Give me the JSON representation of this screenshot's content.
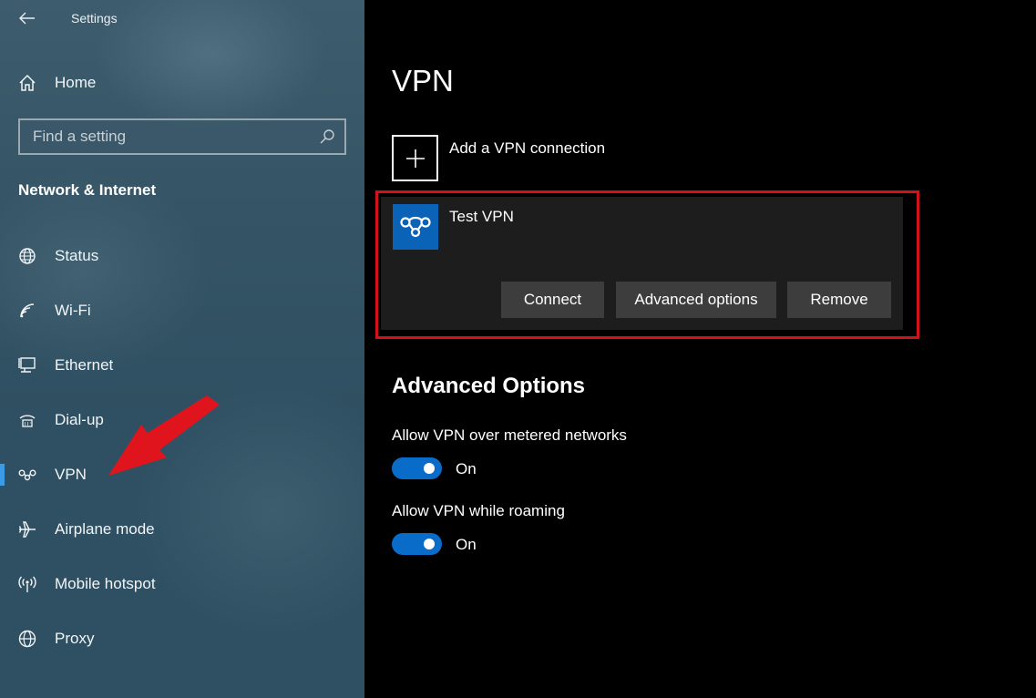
{
  "window": {
    "title": "Settings"
  },
  "sidebar": {
    "home_label": "Home",
    "search_placeholder": "Find a setting",
    "section_title": "Network & Internet",
    "items": [
      {
        "label": "Status",
        "icon": "globe-status-icon"
      },
      {
        "label": "Wi-Fi",
        "icon": "wifi-icon"
      },
      {
        "label": "Ethernet",
        "icon": "ethernet-icon"
      },
      {
        "label": "Dial-up",
        "icon": "dialup-icon"
      },
      {
        "label": "VPN",
        "icon": "vpn-icon",
        "active": true
      },
      {
        "label": "Airplane mode",
        "icon": "airplane-icon"
      },
      {
        "label": "Mobile hotspot",
        "icon": "hotspot-icon"
      },
      {
        "label": "Proxy",
        "icon": "globe-icon"
      }
    ]
  },
  "main": {
    "title": "VPN",
    "add_label": "Add a VPN connection",
    "connection": {
      "name": "Test VPN",
      "connect_label": "Connect",
      "advanced_label": "Advanced options",
      "remove_label": "Remove"
    },
    "advanced": {
      "title": "Advanced Options",
      "metered": {
        "label": "Allow VPN over metered networks",
        "state": "On"
      },
      "roaming": {
        "label": "Allow VPN while roaming",
        "state": "On"
      }
    }
  },
  "colors": {
    "accent": "#0a6cc9",
    "highlight": "#d1121b",
    "vpn_tile": "#0b63b8"
  }
}
